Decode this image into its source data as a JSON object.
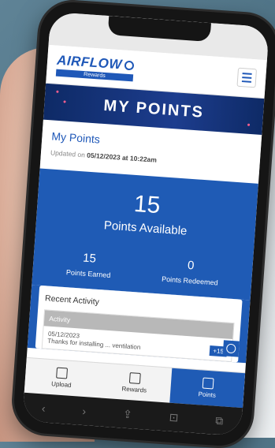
{
  "header": {
    "logo_text": "AIRFLOW",
    "logo_sub": "Rewards"
  },
  "banner": {
    "title": "MY POINTS"
  },
  "summary": {
    "title": "My Points",
    "updated_prefix": "Updated on ",
    "updated_value": "05/12/2023 at 10:22am"
  },
  "points": {
    "available_value": "15",
    "available_label": "Points Available",
    "earned_value": "15",
    "earned_label": "Points Earned",
    "redeemed_value": "0",
    "redeemed_label": "Points Redeemed"
  },
  "activity": {
    "title": "Recent Activity",
    "column_header": "Activity",
    "rows": [
      {
        "date": "05/12/2023",
        "description": "Thanks for installing ... ventilation",
        "points": "+15"
      }
    ]
  },
  "tabs": [
    {
      "label": "Upload",
      "icon": "upload-icon"
    },
    {
      "label": "Rewards",
      "icon": "gift-icon"
    },
    {
      "label": "Points",
      "icon": "coins-icon"
    }
  ],
  "browser": {
    "back": "‹",
    "forward": "›",
    "share": "⇪",
    "bookmarks": "⊡",
    "tabs": "⧉"
  },
  "colors": {
    "brand_blue": "#1f5bb5",
    "banner_dark": "#0e2a66"
  }
}
